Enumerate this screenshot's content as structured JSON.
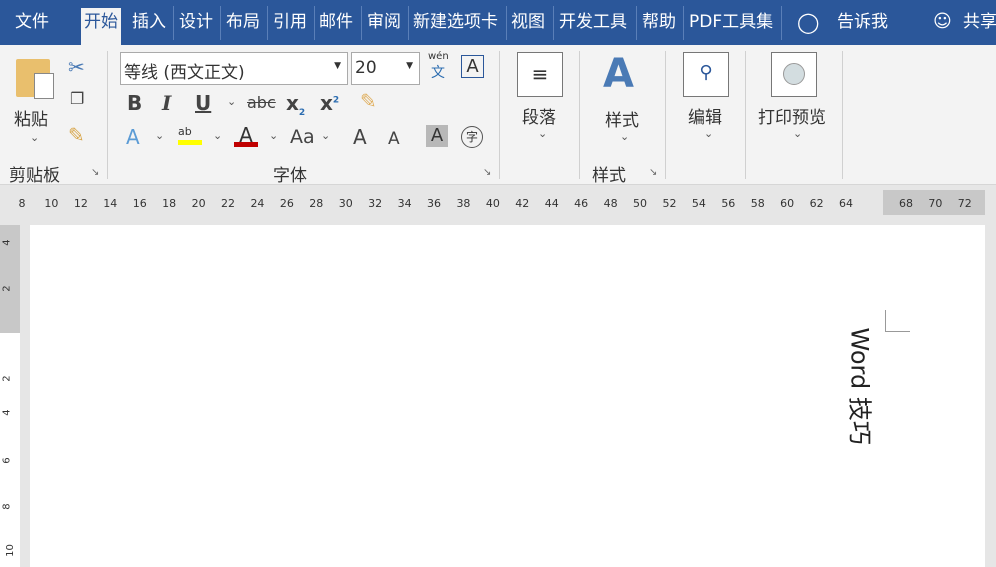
{
  "tabs": [
    "文件",
    "开始",
    "插入",
    "设计",
    "布局",
    "引用",
    "邮件",
    "审阅",
    "新建选项卡",
    "视图",
    "开发工具",
    "帮助",
    "PDF工具集"
  ],
  "tell_me": "告诉我",
  "share": "共享",
  "clipboard": {
    "paste": "粘贴",
    "group": "剪贴板"
  },
  "font": {
    "name": "等线 (西文正文)",
    "size": "20",
    "group": "字体",
    "phonetic_top": "wén",
    "phonetic_bottom": "文",
    "bold": "B",
    "italic": "I",
    "underline": "U",
    "strike": "abc",
    "sub": "x",
    "sup": "x",
    "case": "Aa",
    "grow": "A",
    "shrink": "A",
    "shade": "A",
    "enclose": "字",
    "border": "A"
  },
  "paragraph": {
    "label": "段落"
  },
  "styles": {
    "label": "样式",
    "group": "样式"
  },
  "editing": {
    "label": "编辑"
  },
  "print_preview": {
    "label": "打印预览"
  },
  "ruler": [
    "8",
    "10",
    "12",
    "14",
    "16",
    "18",
    "20",
    "22",
    "24",
    "26",
    "28",
    "30",
    "32",
    "34",
    "36",
    "38",
    "40",
    "42",
    "44",
    "46",
    "48",
    "50",
    "52",
    "54",
    "56",
    "58",
    "60",
    "62",
    "64"
  ],
  "ruler_right": [
    "68",
    "70",
    "72"
  ],
  "vruler": [
    "4",
    "2",
    "2",
    "4",
    "6",
    "8",
    "10"
  ],
  "document": {
    "text": "Word 技巧"
  }
}
